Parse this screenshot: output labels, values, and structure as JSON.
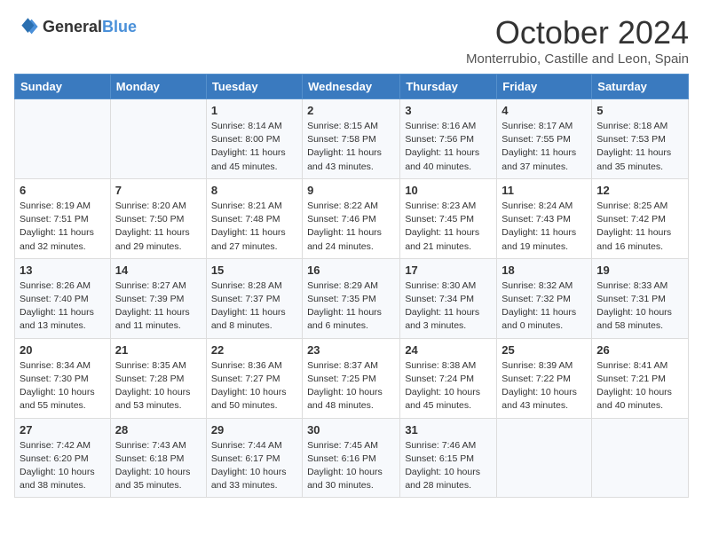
{
  "header": {
    "logo_general": "General",
    "logo_blue": "Blue",
    "month_title": "October 2024",
    "subtitle": "Monterrubio, Castille and Leon, Spain"
  },
  "days_of_week": [
    "Sunday",
    "Monday",
    "Tuesday",
    "Wednesday",
    "Thursday",
    "Friday",
    "Saturday"
  ],
  "weeks": [
    [
      {
        "day": "",
        "info": ""
      },
      {
        "day": "",
        "info": ""
      },
      {
        "day": "1",
        "info": "Sunrise: 8:14 AM\nSunset: 8:00 PM\nDaylight: 11 hours and 45 minutes."
      },
      {
        "day": "2",
        "info": "Sunrise: 8:15 AM\nSunset: 7:58 PM\nDaylight: 11 hours and 43 minutes."
      },
      {
        "day": "3",
        "info": "Sunrise: 8:16 AM\nSunset: 7:56 PM\nDaylight: 11 hours and 40 minutes."
      },
      {
        "day": "4",
        "info": "Sunrise: 8:17 AM\nSunset: 7:55 PM\nDaylight: 11 hours and 37 minutes."
      },
      {
        "day": "5",
        "info": "Sunrise: 8:18 AM\nSunset: 7:53 PM\nDaylight: 11 hours and 35 minutes."
      }
    ],
    [
      {
        "day": "6",
        "info": "Sunrise: 8:19 AM\nSunset: 7:51 PM\nDaylight: 11 hours and 32 minutes."
      },
      {
        "day": "7",
        "info": "Sunrise: 8:20 AM\nSunset: 7:50 PM\nDaylight: 11 hours and 29 minutes."
      },
      {
        "day": "8",
        "info": "Sunrise: 8:21 AM\nSunset: 7:48 PM\nDaylight: 11 hours and 27 minutes."
      },
      {
        "day": "9",
        "info": "Sunrise: 8:22 AM\nSunset: 7:46 PM\nDaylight: 11 hours and 24 minutes."
      },
      {
        "day": "10",
        "info": "Sunrise: 8:23 AM\nSunset: 7:45 PM\nDaylight: 11 hours and 21 minutes."
      },
      {
        "day": "11",
        "info": "Sunrise: 8:24 AM\nSunset: 7:43 PM\nDaylight: 11 hours and 19 minutes."
      },
      {
        "day": "12",
        "info": "Sunrise: 8:25 AM\nSunset: 7:42 PM\nDaylight: 11 hours and 16 minutes."
      }
    ],
    [
      {
        "day": "13",
        "info": "Sunrise: 8:26 AM\nSunset: 7:40 PM\nDaylight: 11 hours and 13 minutes."
      },
      {
        "day": "14",
        "info": "Sunrise: 8:27 AM\nSunset: 7:39 PM\nDaylight: 11 hours and 11 minutes."
      },
      {
        "day": "15",
        "info": "Sunrise: 8:28 AM\nSunset: 7:37 PM\nDaylight: 11 hours and 8 minutes."
      },
      {
        "day": "16",
        "info": "Sunrise: 8:29 AM\nSunset: 7:35 PM\nDaylight: 11 hours and 6 minutes."
      },
      {
        "day": "17",
        "info": "Sunrise: 8:30 AM\nSunset: 7:34 PM\nDaylight: 11 hours and 3 minutes."
      },
      {
        "day": "18",
        "info": "Sunrise: 8:32 AM\nSunset: 7:32 PM\nDaylight: 11 hours and 0 minutes."
      },
      {
        "day": "19",
        "info": "Sunrise: 8:33 AM\nSunset: 7:31 PM\nDaylight: 10 hours and 58 minutes."
      }
    ],
    [
      {
        "day": "20",
        "info": "Sunrise: 8:34 AM\nSunset: 7:30 PM\nDaylight: 10 hours and 55 minutes."
      },
      {
        "day": "21",
        "info": "Sunrise: 8:35 AM\nSunset: 7:28 PM\nDaylight: 10 hours and 53 minutes."
      },
      {
        "day": "22",
        "info": "Sunrise: 8:36 AM\nSunset: 7:27 PM\nDaylight: 10 hours and 50 minutes."
      },
      {
        "day": "23",
        "info": "Sunrise: 8:37 AM\nSunset: 7:25 PM\nDaylight: 10 hours and 48 minutes."
      },
      {
        "day": "24",
        "info": "Sunrise: 8:38 AM\nSunset: 7:24 PM\nDaylight: 10 hours and 45 minutes."
      },
      {
        "day": "25",
        "info": "Sunrise: 8:39 AM\nSunset: 7:22 PM\nDaylight: 10 hours and 43 minutes."
      },
      {
        "day": "26",
        "info": "Sunrise: 8:41 AM\nSunset: 7:21 PM\nDaylight: 10 hours and 40 minutes."
      }
    ],
    [
      {
        "day": "27",
        "info": "Sunrise: 7:42 AM\nSunset: 6:20 PM\nDaylight: 10 hours and 38 minutes."
      },
      {
        "day": "28",
        "info": "Sunrise: 7:43 AM\nSunset: 6:18 PM\nDaylight: 10 hours and 35 minutes."
      },
      {
        "day": "29",
        "info": "Sunrise: 7:44 AM\nSunset: 6:17 PM\nDaylight: 10 hours and 33 minutes."
      },
      {
        "day": "30",
        "info": "Sunrise: 7:45 AM\nSunset: 6:16 PM\nDaylight: 10 hours and 30 minutes."
      },
      {
        "day": "31",
        "info": "Sunrise: 7:46 AM\nSunset: 6:15 PM\nDaylight: 10 hours and 28 minutes."
      },
      {
        "day": "",
        "info": ""
      },
      {
        "day": "",
        "info": ""
      }
    ]
  ]
}
